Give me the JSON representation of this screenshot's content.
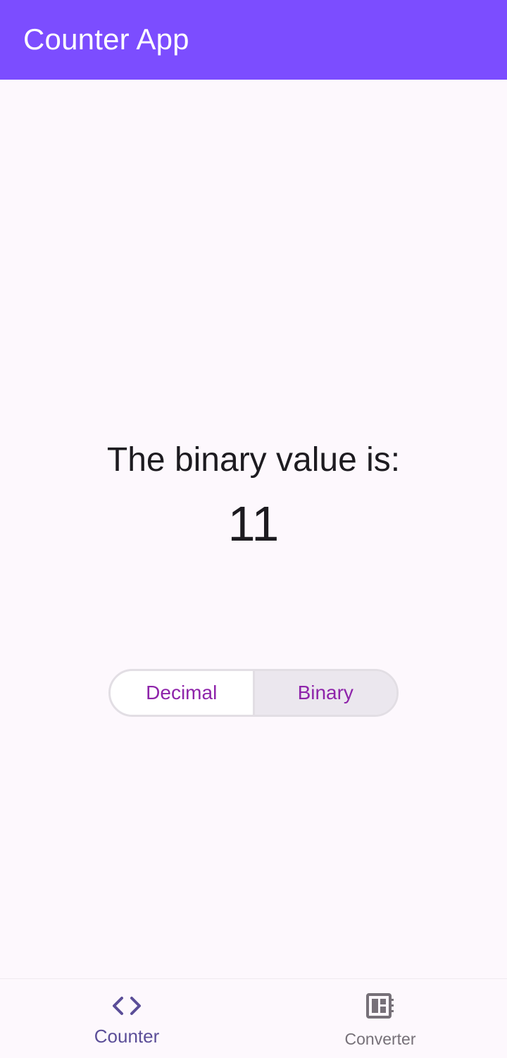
{
  "app_bar": {
    "title": "Counter App",
    "background_color": "#7c4dff"
  },
  "main": {
    "label": "The binary value is:",
    "value": "11"
  },
  "toggle": {
    "options": [
      {
        "label": "Decimal",
        "selected": false
      },
      {
        "label": "Binary",
        "selected": true
      }
    ],
    "accent_color": "#8e24aa"
  },
  "nav": {
    "items": [
      {
        "label": "Counter",
        "icon": "code-icon",
        "active": true
      },
      {
        "label": "Converter",
        "icon": "dashboard-icon",
        "active": false
      }
    ],
    "active_color": "#5b4e98",
    "inactive_color": "#767078"
  }
}
